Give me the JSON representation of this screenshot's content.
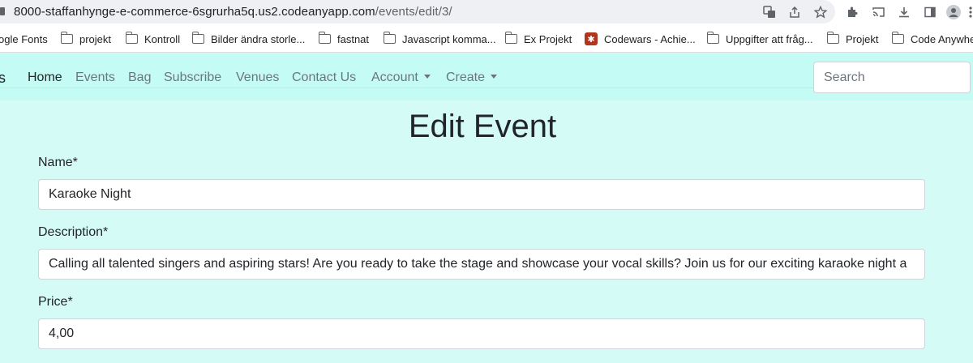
{
  "browser": {
    "url_host": "8000-staffanhynge-e-commerce-6sgrurha5q.us2.codeanyapp.com",
    "url_path": "/events/edit/3/",
    "toolbar_icons": [
      "translate-icon",
      "share-icon",
      "star-icon",
      "extensions-icon",
      "cast-icon",
      "download-icon",
      "sidepanel-icon",
      "profile-icon",
      "menu-icon"
    ]
  },
  "bookmarks": [
    {
      "label": "ogle Fonts",
      "icon": "none"
    },
    {
      "label": "projekt",
      "icon": "folder-icon"
    },
    {
      "label": "Kontroll",
      "icon": "folder-icon"
    },
    {
      "label": "Bilder ändra storle...",
      "icon": "folder-icon"
    },
    {
      "label": "fastnat",
      "icon": "folder-icon"
    },
    {
      "label": "Javascript komma...",
      "icon": "folder-icon"
    },
    {
      "label": "Ex Projekt",
      "icon": "folder-icon"
    },
    {
      "label": "Codewars - Achie...",
      "icon": "codewars-icon"
    },
    {
      "label": "Uppgifter att fråg...",
      "icon": "folder-icon"
    },
    {
      "label": "Projekt",
      "icon": "folder-icon"
    },
    {
      "label": "Code Anywhe",
      "icon": "folder-icon"
    }
  ],
  "nav": {
    "brand": "s",
    "links": [
      "Home",
      "Events",
      "Bag",
      "Subscribe",
      "Venues",
      "Contact Us",
      "Account",
      "Create"
    ],
    "search_placeholder": "Search"
  },
  "form": {
    "title": "Edit Event",
    "name_label": "Name*",
    "name_value": "Karaoke Night",
    "description_label": "Description*",
    "description_value": "Calling all talented singers and aspiring stars! Are you ready to take the stage and showcase your vocal skills? Join us for our exciting karaoke night a",
    "price_label": "Price*",
    "price_value": "4,00"
  },
  "colors": {
    "page_bg": "#d4fbf6",
    "navbar_bg": "#c4fcf5",
    "text": "#212529",
    "muted": "#6c757d"
  }
}
